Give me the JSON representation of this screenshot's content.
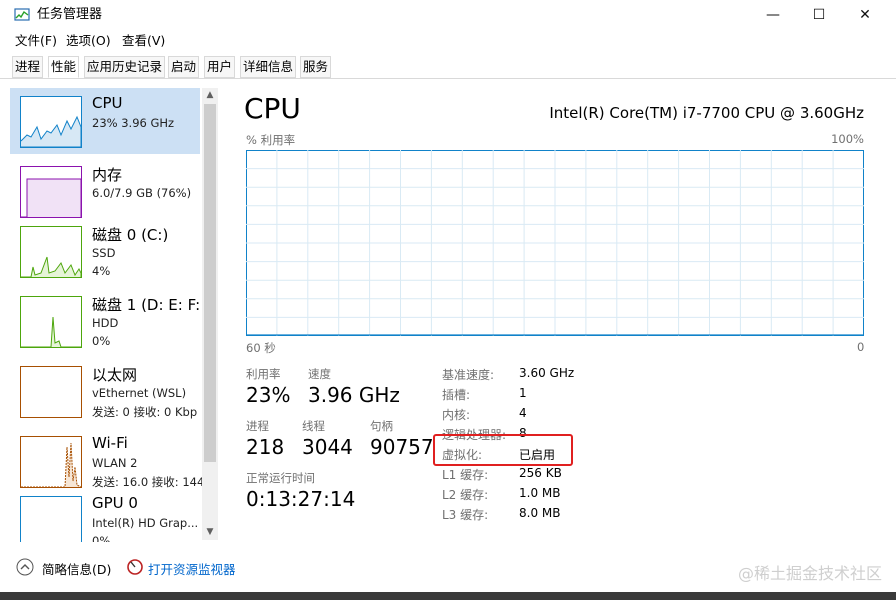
{
  "window": {
    "title": "任务管理器",
    "controls": {
      "minimize": "—",
      "maximize": "☐",
      "close": "✕"
    }
  },
  "menu": [
    "文件(F)",
    "选项(O)",
    "查看(V)"
  ],
  "tabs": [
    {
      "label": "进程",
      "active": false
    },
    {
      "label": "性能",
      "active": true
    },
    {
      "label": "应用历史记录",
      "active": false
    },
    {
      "label": "启动",
      "active": false
    },
    {
      "label": "用户",
      "active": false
    },
    {
      "label": "详细信息",
      "active": false
    },
    {
      "label": "服务",
      "active": false
    }
  ],
  "sidebar": {
    "items": [
      {
        "name": "CPU",
        "line1": "23% 3.96 GHz",
        "line2": "",
        "color": "#1182c9",
        "selected": true
      },
      {
        "name": "内存",
        "line1": "6.0/7.9 GB (76%)",
        "line2": "",
        "color": "#8b12ae",
        "selected": false
      },
      {
        "name": "磁盘 0 (C:)",
        "line1": "SSD",
        "line2": "4%",
        "color": "#4da60c",
        "selected": false
      },
      {
        "name": "磁盘 1 (D: E: F:",
        "line1": "HDD",
        "line2": "0%",
        "color": "#4da60c",
        "selected": false
      },
      {
        "name": "以太网",
        "line1": "vEthernet (WSL)",
        "line2": "发送: 0 接收: 0 Kbp",
        "color": "#a74f01",
        "selected": false
      },
      {
        "name": "Wi-Fi",
        "line1": "WLAN 2",
        "line2": "发送: 16.0 接收: 144",
        "color": "#a74f01",
        "selected": false
      },
      {
        "name": "GPU 0",
        "line1": "Intel(R) HD Grap...",
        "line2": "0%",
        "color": "#1182c9",
        "selected": false
      }
    ]
  },
  "main": {
    "title": "CPU",
    "model": "Intel(R) Core(TM) i7-7700 CPU @ 3.60GHz",
    "graph": {
      "ylabel": "% 利用率",
      "ymax_label": "100%",
      "x_left_label": "60 秒",
      "x_right_label": "0",
      "line_color": "#1182c9",
      "fill_color": "#f1f6fa",
      "grid_color": "#d9eaf4",
      "ymax": 100,
      "ymin": 0,
      "x": [
        0,
        1,
        2,
        3,
        4,
        5,
        6,
        7,
        8,
        9,
        10,
        11,
        12,
        13,
        14,
        15,
        16,
        17,
        18,
        19,
        20,
        21,
        22,
        23,
        24,
        25,
        26,
        27,
        28,
        29,
        30,
        31,
        32,
        33,
        34,
        35,
        36,
        37,
        38,
        39,
        40,
        41,
        42,
        43,
        44,
        45,
        46,
        47,
        48,
        49,
        50,
        51,
        52,
        53,
        54,
        55,
        56,
        57,
        58,
        59,
        60
      ],
      "values": [
        0,
        0,
        0,
        0,
        0,
        0,
        0,
        0,
        0,
        0,
        0,
        0,
        0,
        0,
        0,
        0,
        0,
        0,
        0,
        0,
        0,
        0,
        0,
        0,
        0,
        0,
        0,
        0,
        0,
        0,
        0,
        0,
        0,
        0,
        0,
        0,
        0,
        0,
        0,
        0,
        0,
        0,
        0,
        0,
        0,
        0,
        0,
        0,
        0,
        0,
        0,
        0,
        0,
        0,
        0,
        0,
        0,
        0,
        0,
        0,
        0
      ]
    },
    "stats": {
      "util_label": "利用率",
      "util_value": "23%",
      "speed_label": "速度",
      "speed_value": "3.96 GHz",
      "proc_label": "进程",
      "proc_value": "218",
      "thread_label": "线程",
      "thread_value": "3044",
      "handle_label": "句柄",
      "handle_value": "90757",
      "uptime_label": "正常运行时间",
      "uptime_value": "0:13:27:14"
    },
    "details": [
      {
        "label": "基准速度:",
        "value": "3.60 GHz"
      },
      {
        "label": "插槽:",
        "value": "1"
      },
      {
        "label": "内核:",
        "value": "4"
      },
      {
        "label": "逻辑处理器:",
        "value": "8"
      },
      {
        "label": "虚拟化:",
        "value": "已启用"
      },
      {
        "label": "L1 缓存:",
        "value": "256 KB"
      },
      {
        "label": "L2 缓存:",
        "value": "1.0 MB"
      },
      {
        "label": "L3 缓存:",
        "value": "8.0 MB"
      }
    ],
    "highlight_color": "#e02020"
  },
  "footer": {
    "summary": "简略信息(D)",
    "monitor": "打开资源监视器"
  },
  "watermark": "@稀土掘金技术社区"
}
